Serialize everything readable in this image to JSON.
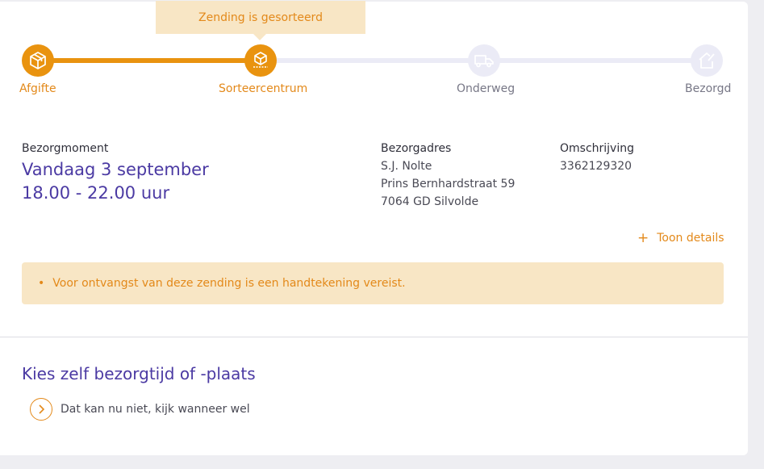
{
  "tracker": {
    "tooltip": "Zending is gesorteerd",
    "steps": [
      {
        "label": "Afgifte",
        "icon": "box-icon",
        "state": "done"
      },
      {
        "label": "Sorteercentrum",
        "icon": "sorting-icon",
        "state": "current"
      },
      {
        "label": "Onderweg",
        "icon": "truck-icon",
        "state": "todo"
      },
      {
        "label": "Bezorgd",
        "icon": "house-icon",
        "state": "todo"
      }
    ],
    "progress_fraction": 0.333,
    "active_color": "#e9930f",
    "inactive_color": "#ebebf6"
  },
  "delivery": {
    "moment_label": "Bezorgmoment",
    "date": "Vandaag 3 september",
    "time": "18.00 - 22.00 uur",
    "address_label": "Bezorgadres",
    "address": [
      "S.J. Nolte",
      "Prins Bernhardstraat 59",
      "7064 GD Silvolde"
    ],
    "description_label": "Omschrijving",
    "description": "3362129320"
  },
  "details_toggle": {
    "icon": "+",
    "label": "Toon details"
  },
  "notice": {
    "bullet": "•",
    "text": "Voor ontvangst van deze zending is een handtekening vereist."
  },
  "choose": {
    "title": "Kies zelf bezorgtijd of -plaats",
    "link": "Dat kan nu niet, kijk wanneer wel"
  },
  "colors": {
    "accent_orange": "#e3891a",
    "brand_purple": "#4b3aa3",
    "notice_bg": "#f8e6c5"
  }
}
